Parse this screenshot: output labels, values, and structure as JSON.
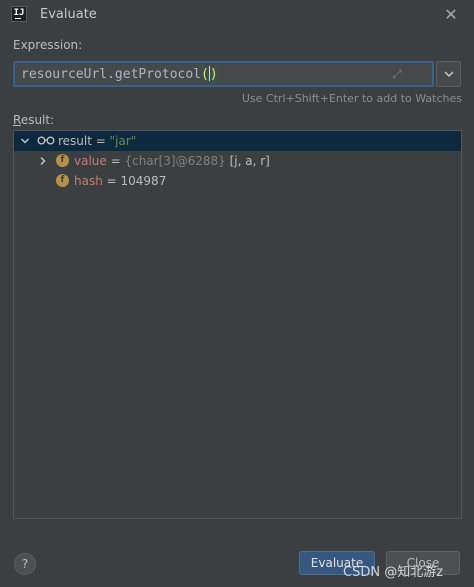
{
  "window": {
    "title": "Evaluate",
    "app_icon_text": "IJ",
    "close_glyph": "✕"
  },
  "expression": {
    "label": "Expression:",
    "value_prefix": "resourceUrl.getProtocol",
    "value_open_paren": "(",
    "value_close_paren": ")",
    "hint": "Use Ctrl+Shift+Enter to add to Watches"
  },
  "result": {
    "label_underlined": "R",
    "label_rest": "esult:",
    "rows": [
      {
        "name": "result",
        "eq": " = ",
        "value": "\"jar\""
      },
      {
        "name": "value",
        "eq": " = ",
        "type_ref": "{char[3]@6288}",
        "value": " [j, a, r]"
      },
      {
        "name": "hash",
        "eq": " = ",
        "value": "104987"
      }
    ]
  },
  "buttons": {
    "help": "?",
    "evaluate": "Evaluate",
    "close": "Close"
  },
  "watermark": "CSDN @知北游z",
  "colors": {
    "background": "#3c3f41",
    "selected_row": "#0d293e",
    "accent_button": "#365880",
    "field_name": "#c57b76",
    "string_value": "#6a8759",
    "field_icon": "#b7914a"
  },
  "icons": {
    "field": "f",
    "expand": "⤢"
  }
}
